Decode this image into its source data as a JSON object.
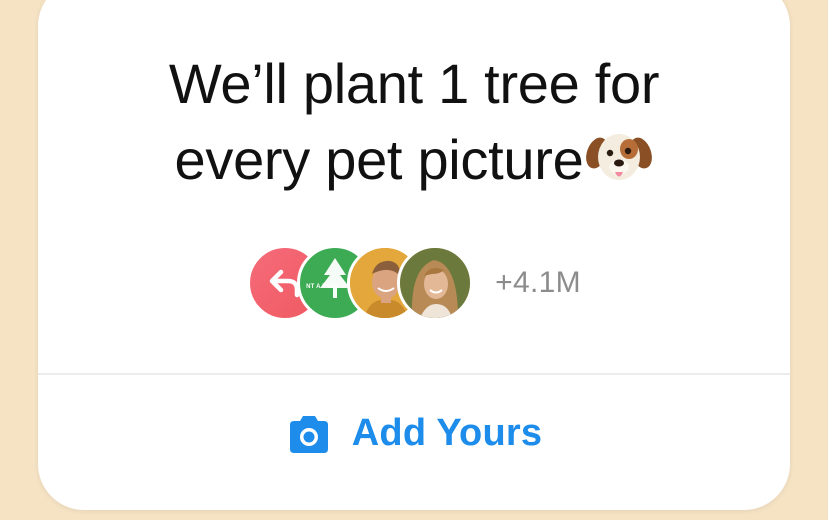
{
  "sticker": {
    "title_line1": "We’ll plant 1 tree for",
    "title_line2": "every pet picture",
    "title_emoji": "dog-face-emoji",
    "participants": {
      "avatars": [
        {
          "kind": "share-icon",
          "color": "#f0606c"
        },
        {
          "kind": "brand-logo",
          "text": "NT A TREE",
          "color": "#3cab54"
        },
        {
          "kind": "person-photo"
        },
        {
          "kind": "person-photo"
        }
      ],
      "count_label": "+4.1M"
    },
    "action": {
      "label": "Add Yours",
      "icon": "camera-icon",
      "color": "#1d8cea"
    }
  },
  "colors": {
    "background": "#f6e3c4",
    "card": "#ffffff",
    "title_text": "#111111",
    "count_text": "#8c8c8c"
  }
}
